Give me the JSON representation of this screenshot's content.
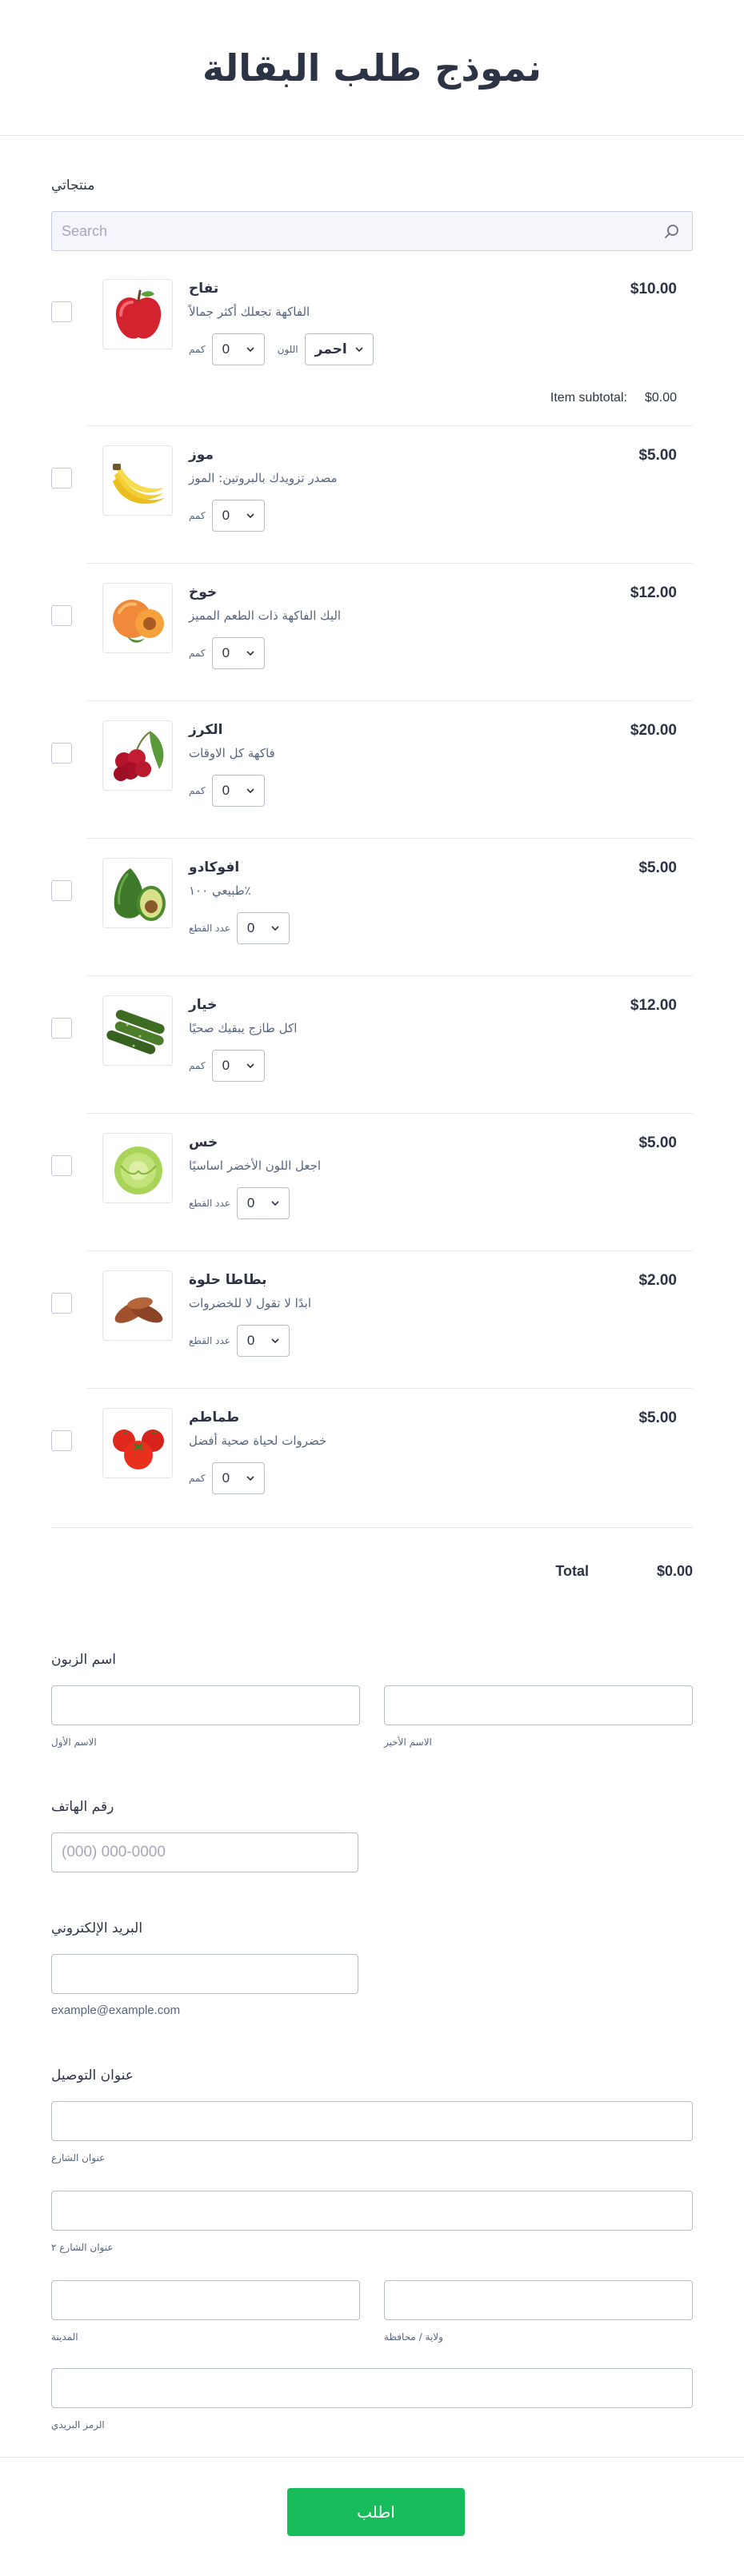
{
  "form": {
    "title": "نموذج طلب البقالة"
  },
  "products_section": {
    "label": "منتجاتي",
    "search_placeholder": "Search",
    "items": [
      {
        "name": "تفاح",
        "description": "الفاكهة تجعلك أكثر جمالاً",
        "price": "$10.00",
        "qty_label": "كمم",
        "qty_value": "0",
        "color_label": "اللون",
        "color_value": "احمر",
        "subtotal_label": "Item subtotal:",
        "subtotal_value": "$0.00",
        "icon": "apple-icon"
      },
      {
        "name": "موز",
        "description": "مصدر تزويدك بالبروتين: الموز",
        "price": "$5.00",
        "qty_label": "كمم",
        "qty_value": "0",
        "icon": "banana-icon"
      },
      {
        "name": "خوخ",
        "description": "اليك الفاكهة ذات الطعم المميز",
        "price": "$12.00",
        "qty_label": "كمم",
        "qty_value": "0",
        "icon": "peach-icon"
      },
      {
        "name": "الكرز",
        "description": "فاكهة كل الاوقات",
        "price": "$20.00",
        "qty_label": "كمم",
        "qty_value": "0",
        "icon": "cherry-icon"
      },
      {
        "name": "افوكادو",
        "description": "طبيعي ١٠٠٪",
        "price": "$5.00",
        "qty_label": "عدد القطع",
        "qty_value": "0",
        "icon": "avocado-icon"
      },
      {
        "name": "خيار",
        "description": "اكل طازج يبقيك صحيًا",
        "price": "$12.00",
        "qty_label": "كمم",
        "qty_value": "0",
        "icon": "cucumber-icon"
      },
      {
        "name": "خس",
        "description": "اجعل اللون الأخضر اساسيًا",
        "price": "$5.00",
        "qty_label": "عدد القطع",
        "qty_value": "0",
        "icon": "lettuce-icon"
      },
      {
        "name": "بطاطا حلوة",
        "description": "ابدًا لا تقول لا للخضروات",
        "price": "$2.00",
        "qty_label": "عدد القطع",
        "qty_value": "0",
        "icon": "sweet-potato-icon"
      },
      {
        "name": "طماطم",
        "description": "خضروات لحياة صحية أفضل",
        "price": "$5.00",
        "qty_label": "كمم",
        "qty_value": "0",
        "icon": "tomato-icon"
      }
    ],
    "total_label": "Total",
    "total_value": "$0.00"
  },
  "customer": {
    "name_label": "اسم الزبون",
    "first_name_sub": "الاسم الأول",
    "last_name_sub": "الاسم الأخير",
    "phone_label": "رقم الهاتف",
    "phone_placeholder": "(000) 000-0000",
    "email_label": "البريد الإلكتروني",
    "email_hint": "example@example.com",
    "address_label": "عنوان التوصيل",
    "street_sub": "عنوان الشارع",
    "street2_sub": "عنوان الشارع ٢",
    "city_sub": "المدينة",
    "state_sub": "ولاية / محافظة",
    "zip_sub": "الرمز البريدي"
  },
  "footer": {
    "submit_label": "اطلب"
  },
  "colors": {
    "accent": "#18bd5b",
    "text": "#2c3345",
    "border": "#b8bdc9"
  }
}
